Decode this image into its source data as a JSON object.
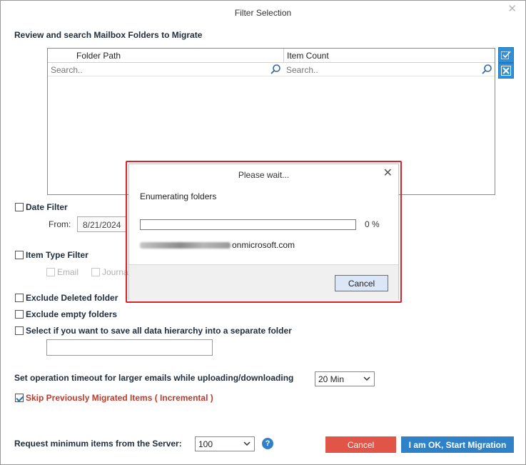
{
  "window": {
    "title": "Filter Selection"
  },
  "folders": {
    "heading": "Review and search Mailbox Folders to Migrate",
    "columns": [
      "Folder Path",
      "Item Count"
    ],
    "search_placeholder": "Search.."
  },
  "date_filter": {
    "label": "Date Filter",
    "from_label": "From:",
    "from_value": "8/21/2024"
  },
  "item_type_filter": {
    "label": "Item Type Filter",
    "options": [
      "Email",
      "Journal"
    ]
  },
  "options": {
    "exclude_deleted": "Exclude Deleted folder",
    "exclude_empty": "Exclude empty folders",
    "separate_folder": "Select if you want to save all data hierarchy into a separate folder"
  },
  "timeout": {
    "label": "Set operation timeout for larger emails while uploading/downloading",
    "value": "20 Min"
  },
  "incremental": {
    "label": "Skip Previously Migrated Items ( Incremental )"
  },
  "request": {
    "label": "Request minimum items from the Server:",
    "value": "100",
    "help": "?"
  },
  "buttons": {
    "cancel": "Cancel",
    "start": "I am OK, Start Migration"
  },
  "modal": {
    "title": "Please wait...",
    "message": "Enumerating folders",
    "progress_percent": 0,
    "percent_label": "0 %",
    "account_suffix": "onmicrosoft.com",
    "cancel": "Cancel"
  }
}
